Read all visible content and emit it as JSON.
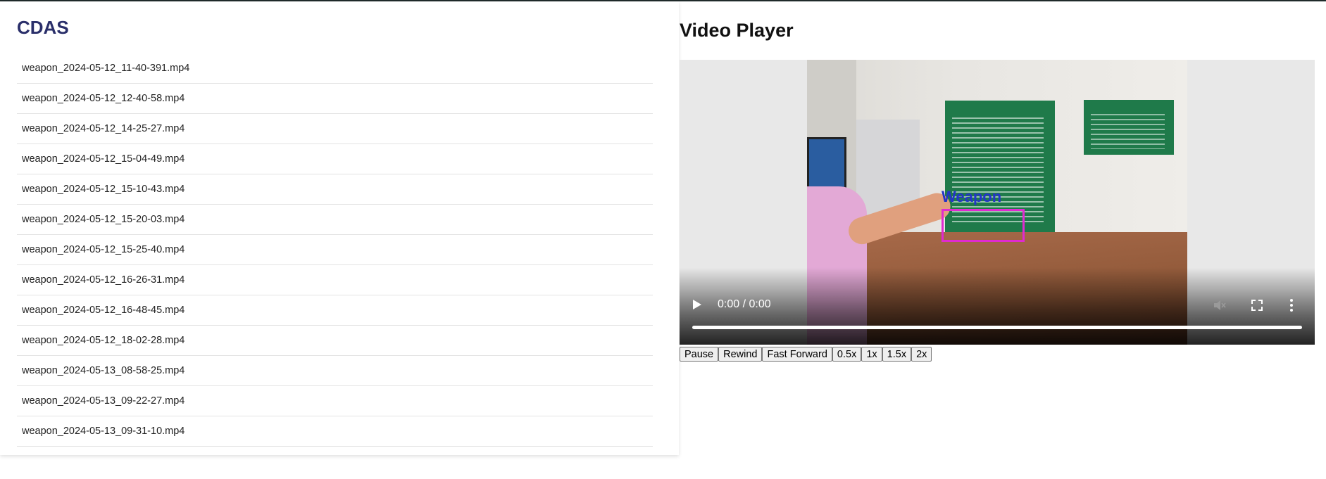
{
  "app": {
    "title": "CDAS"
  },
  "files": [
    "weapon_2024-05-12_11-40-391.mp4",
    "weapon_2024-05-12_12-40-58.mp4",
    "weapon_2024-05-12_14-25-27.mp4",
    "weapon_2024-05-12_15-04-49.mp4",
    "weapon_2024-05-12_15-10-43.mp4",
    "weapon_2024-05-12_15-20-03.mp4",
    "weapon_2024-05-12_15-25-40.mp4",
    "weapon_2024-05-12_16-26-31.mp4",
    "weapon_2024-05-12_16-48-45.mp4",
    "weapon_2024-05-12_18-02-28.mp4",
    "weapon_2024-05-13_08-58-25.mp4",
    "weapon_2024-05-13_09-22-27.mp4",
    "weapon_2024-05-13_09-31-10.mp4"
  ],
  "player": {
    "title": "Video Player",
    "time": "0:00 / 0:00",
    "detection_label": "Weapon",
    "icons": {
      "play": "play-icon",
      "mute": "volume-muted-icon",
      "fullscreen": "fullscreen-icon",
      "more": "more-vertical-icon"
    }
  },
  "controls": {
    "pause": "Pause",
    "rewind": "Rewind",
    "fast_forward": "Fast Forward",
    "speed_05": "0.5x",
    "speed_1": "1x",
    "speed_15": "1.5x",
    "speed_2": "2x"
  },
  "colors": {
    "title": "#2a2f6a",
    "detection_box": "#e02ad0",
    "detection_label": "#2434c8"
  }
}
